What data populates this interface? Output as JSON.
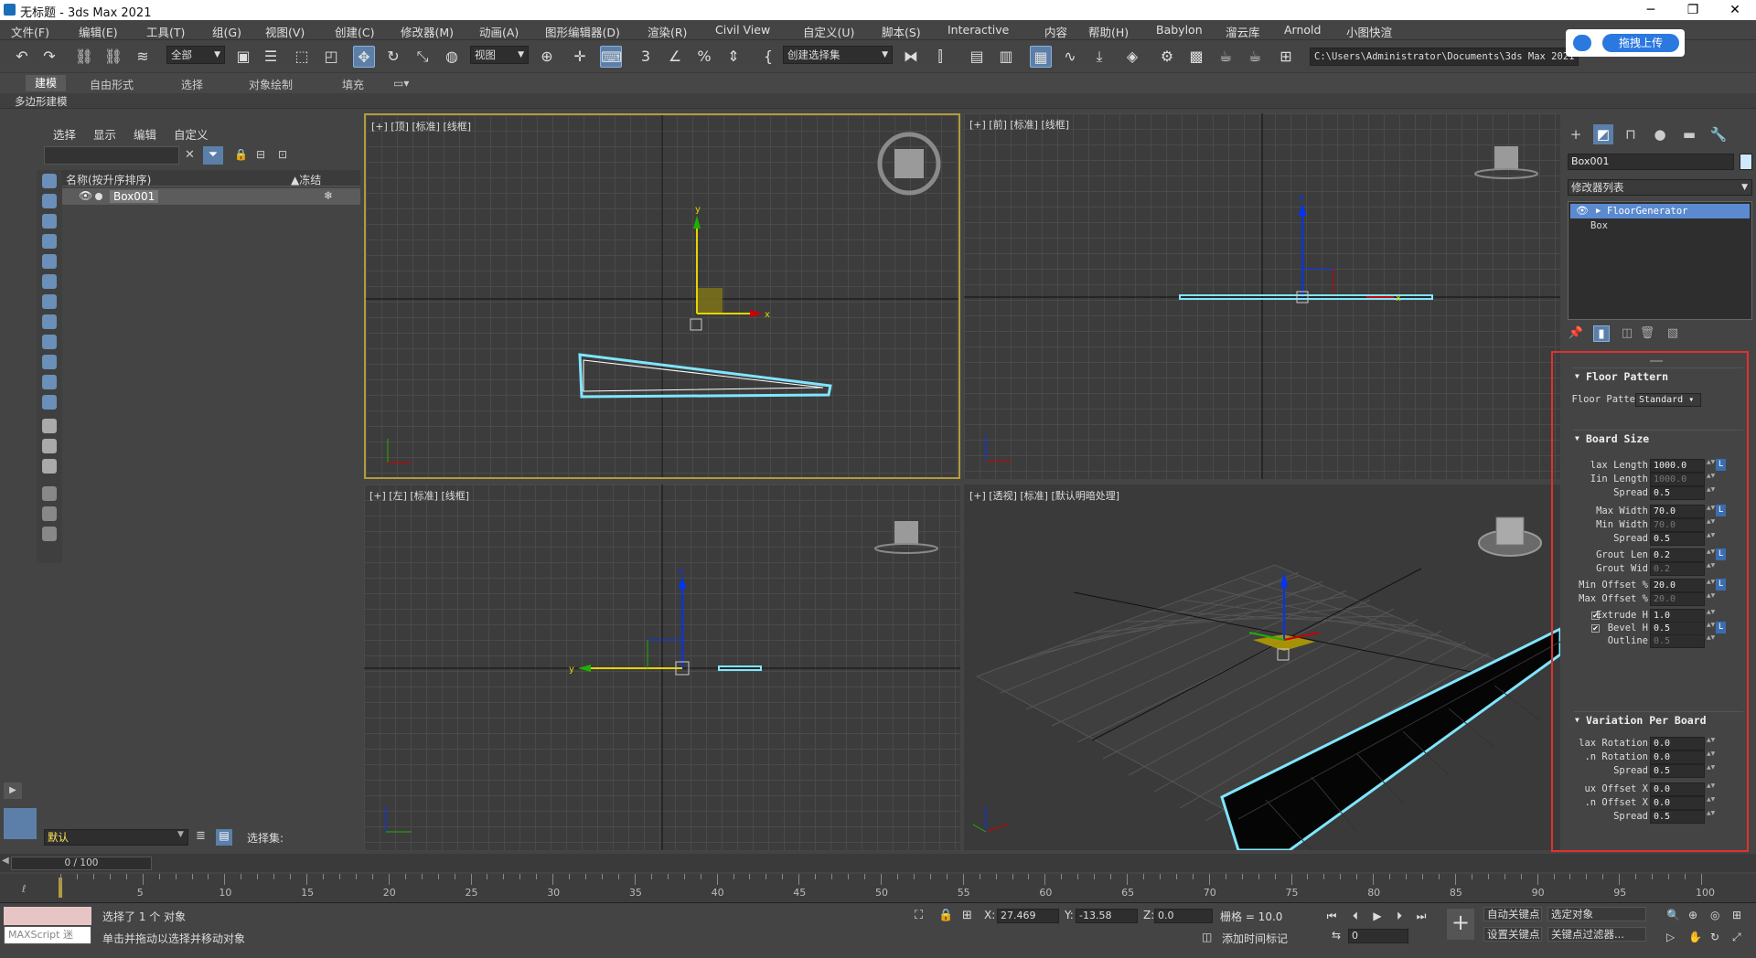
{
  "window": {
    "title": "无标题 - 3ds Max 2021",
    "min": "─",
    "max": "❐",
    "close": "✕"
  },
  "menu": [
    "文件(F)",
    "编辑(E)",
    "工具(T)",
    "组(G)",
    "视图(V)",
    "创建(C)",
    "修改器(M)",
    "动画(A)",
    "图形编辑器(D)",
    "渲染(R)",
    "Civil View",
    "自定义(U)",
    "脚本(S)",
    "Interactive",
    "内容",
    "帮助(H)",
    "Babylon",
    "溜云库",
    "Arnold",
    "小图快渲"
  ],
  "toolbar": {
    "selection_filter": "全部",
    "ref_coord": "视图",
    "named_selection": "创建选择集",
    "path": "C:\\Users\\Administrator\\Documents\\3ds Max 2021"
  },
  "upload_label": "拖拽上传",
  "ribbon": {
    "tabs": [
      "建模",
      "自由形式",
      "选择",
      "对象绘制",
      "填充"
    ],
    "sub": "多边形建模"
  },
  "explorer": {
    "tabs": [
      "选择",
      "显示",
      "编辑",
      "自定义"
    ],
    "col_name": "名称(按升序排序)",
    "col_frozen": "▲冻结",
    "object": "Box001",
    "layer": "默认",
    "selset_label": "选择集:"
  },
  "viewports": {
    "top": "[+] [顶] [标准] [线框]",
    "front": "[+] [前] [标准] [线框]",
    "left": "[+] [左] [标准] [线框]",
    "persp": "[+] [透视] [标准] [默认明暗处理]"
  },
  "cmd": {
    "object_name": "Box001",
    "modifier_list": "修改器列表",
    "stack": [
      "FloorGenerator",
      "Box"
    ]
  },
  "rollouts": {
    "floor_pattern": {
      "title": "Floor Pattern",
      "label": "Floor Patte",
      "value": "Standard"
    },
    "board_size": {
      "title": "Board Size",
      "rows": [
        {
          "label": "lax Length",
          "value": "1000.0",
          "dim": false
        },
        {
          "label": "Iin Length",
          "value": "1000.0",
          "dim": true
        },
        {
          "label": "Spread",
          "value": "0.5",
          "dim": false
        },
        {
          "label": "Max Width",
          "value": "70.0",
          "dim": false
        },
        {
          "label": "Min Width",
          "value": "70.0",
          "dim": true
        },
        {
          "label": "Spread",
          "value": "0.5",
          "dim": false
        },
        {
          "label": "Grout Len",
          "value": "0.2",
          "dim": false
        },
        {
          "label": "Grout Wid",
          "value": "0.2",
          "dim": true
        },
        {
          "label": "Min Offset %",
          "value": "20.0",
          "dim": false
        },
        {
          "label": "Max Offset %",
          "value": "20.0",
          "dim": true
        },
        {
          "label": "Extrude H",
          "value": "1.0",
          "dim": false
        },
        {
          "label": "Bevel H",
          "value": "0.5",
          "dim": false
        },
        {
          "label": "Outline",
          "value": "0.5",
          "dim": true
        }
      ]
    },
    "variation": {
      "title": "Variation Per Board",
      "rows": [
        {
          "label": "lax Rotation",
          "value": "0.0"
        },
        {
          "label": ".n Rotation",
          "value": "0.0"
        },
        {
          "label": "Spread",
          "value": "0.5"
        },
        {
          "label": "ux Offset X",
          "value": "0.0"
        },
        {
          "label": ".n Offset X",
          "value": "0.0"
        },
        {
          "label": "Spread",
          "value": "0.5"
        }
      ]
    }
  },
  "timeline": {
    "slider": "0 / 100",
    "ticks": [
      "5",
      "10",
      "15",
      "20",
      "25",
      "30",
      "35",
      "40",
      "45",
      "50",
      "55",
      "60",
      "65",
      "70",
      "75",
      "80",
      "85",
      "90",
      "95",
      "100"
    ]
  },
  "status": {
    "maxscript": "MAXScript 迷",
    "selected": "选择了 1 个 对象",
    "hint": "单击并拖动以选择并移动对象",
    "x": "27.469",
    "y": "-13.58",
    "z": "0.0",
    "grid": "栅格 = 10.0",
    "add_time_tag": "添加时间标记",
    "auto_key": "自动关键点",
    "set_key": "设置关键点",
    "key_mode": "选定对象",
    "key_filter": "关键点过滤器...",
    "frame": "0"
  }
}
